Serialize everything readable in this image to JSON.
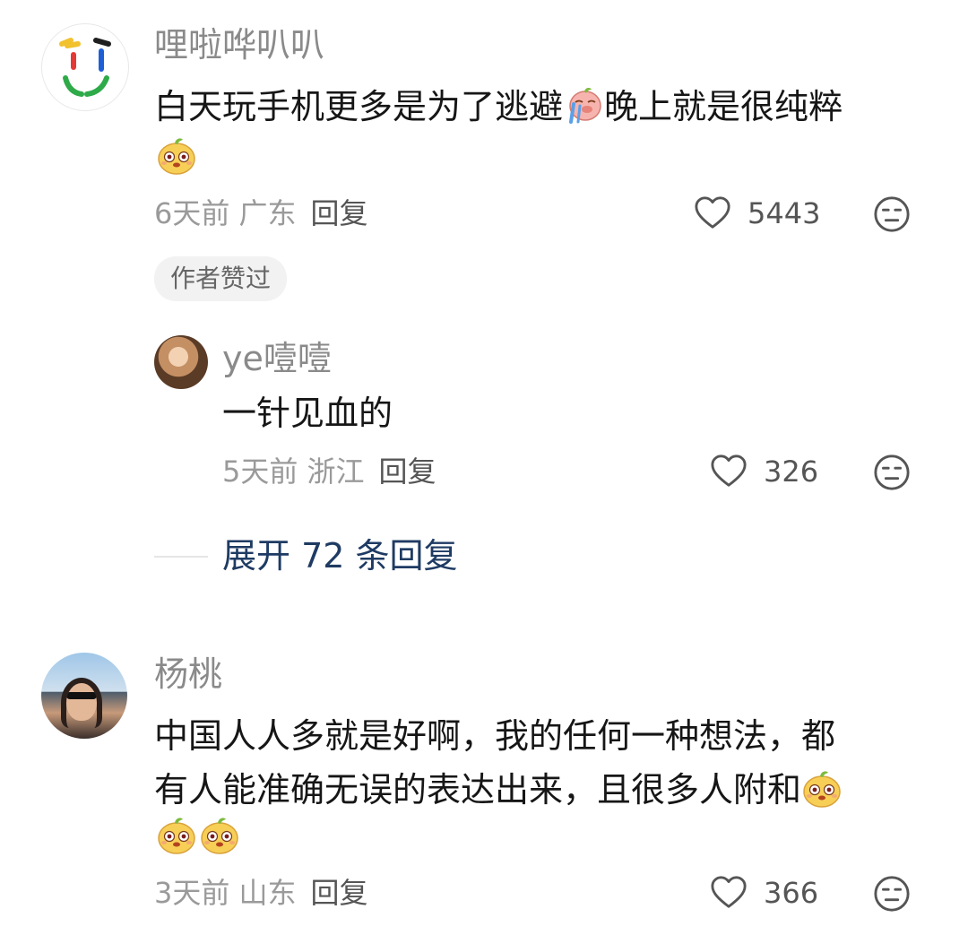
{
  "comments": [
    {
      "username": "哩啦哗叭叭",
      "line1": "白天玩手机更多是为了逃避",
      "line1_after": "晚上就是很纯粹",
      "meta": "6天前 广东",
      "reply": "回复",
      "likes": "5443",
      "badge": "作者赞过",
      "icons": [
        "crying-pig-emoji",
        "happy-mango-emoji",
        "heart-icon",
        "meh-face-icon"
      ]
    },
    {
      "username": "杨桃",
      "line1": "中国人人多就是好啊，我的任何一种想法，都",
      "line2": "有人能准确无误的表达出来，且很多人附和",
      "meta": "3天前 山东",
      "reply": "回复",
      "likes": "366",
      "icons": [
        "happy-mango-emoji",
        "heart-icon",
        "meh-face-icon"
      ]
    }
  ],
  "reply": {
    "username": "ye噎噎",
    "text": "一针见血的",
    "meta": "5天前 浙江",
    "reply": "回复",
    "likes": "326"
  },
  "expand": {
    "label": "展开 72 条回复"
  },
  "colors": {
    "username": "#8a8a8a",
    "content": "#161616",
    "expand": "#1f3b63",
    "badge_bg": "#f2f2f2"
  }
}
